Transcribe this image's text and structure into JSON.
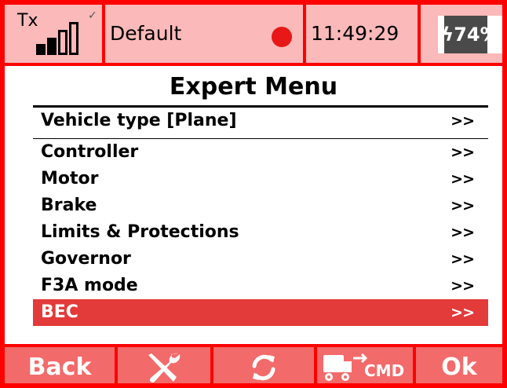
{
  "status_bar": {
    "tx_label": "Tx",
    "signal_bars_filled": 2,
    "signal_bars_total": 4,
    "signal_check": "✓",
    "model_name": "Default",
    "recording_indicator_color": "#e81818",
    "time": "11:49:29",
    "battery": {
      "icon": "charging-bolt-icon",
      "text": "ϟ74%",
      "percent": 74
    }
  },
  "title": "Expert Menu",
  "menu": {
    "items": [
      {
        "label": "Vehicle type [Plane]",
        "arrow": ">>"
      },
      {
        "label": "Controller",
        "arrow": ">>"
      },
      {
        "label": "Motor",
        "arrow": ">>"
      },
      {
        "label": "Brake",
        "arrow": ">>"
      },
      {
        "label": "Limits & Protections",
        "arrow": ">>"
      },
      {
        "label": "Governor",
        "arrow": ">>"
      },
      {
        "label": "F3A mode",
        "arrow": ">>"
      },
      {
        "label": "BEC",
        "arrow": ">>",
        "selected": true
      }
    ]
  },
  "toolbar": {
    "back_label": "Back",
    "tools_icon": "wrench-screwdriver-icon",
    "refresh_icon": "refresh-icon",
    "cmd_label": "CMD",
    "cmd_icon": "vehicle-cmd-icon",
    "ok_label": "Ok"
  },
  "colors": {
    "frame": "#ff0000",
    "status_bg": "#fbb9b9",
    "selected_bg": "#e33a3a",
    "toolbar_bg": "#f36a6a"
  }
}
